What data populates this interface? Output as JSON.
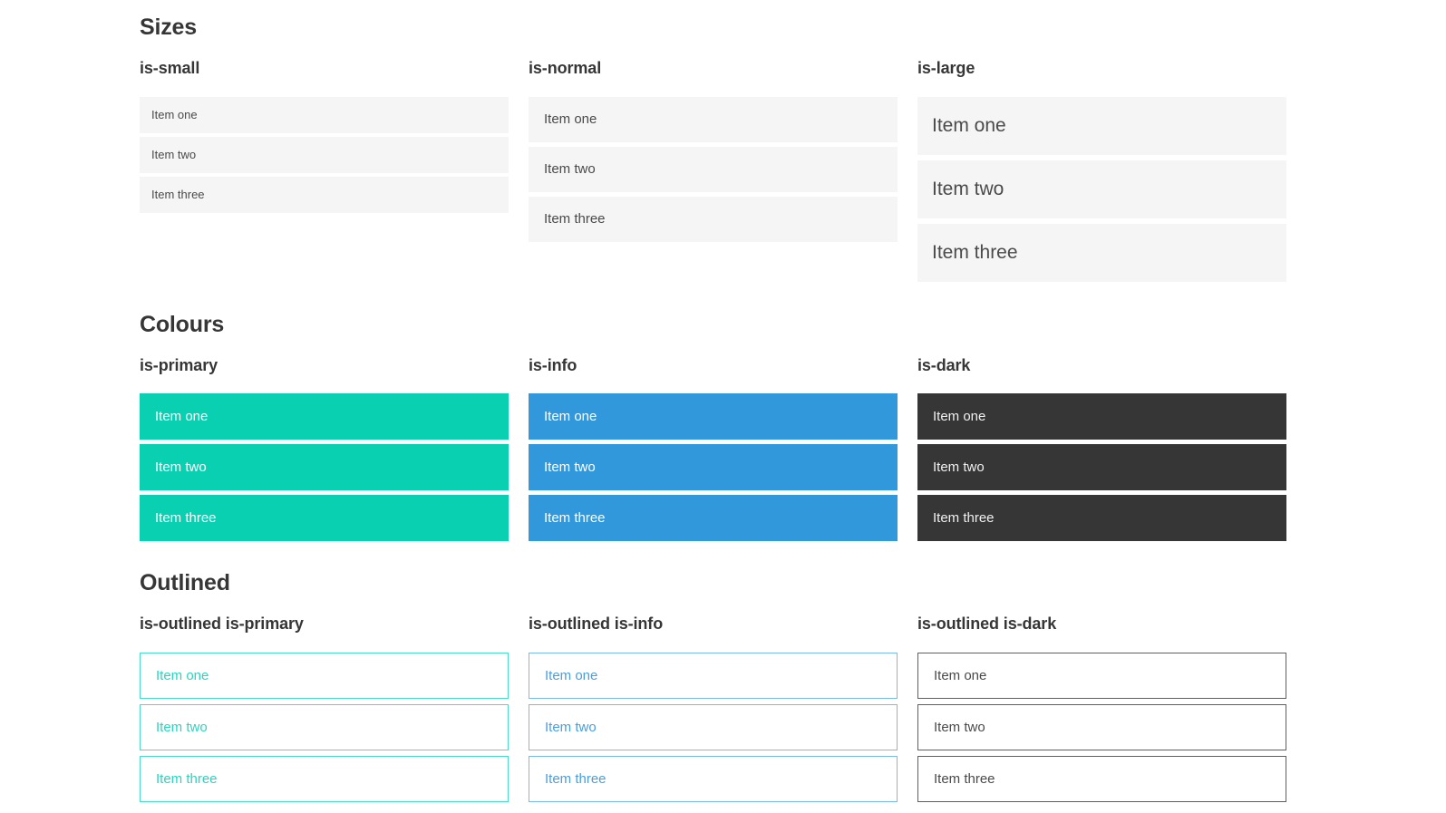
{
  "sections": [
    {
      "title": "Sizes",
      "groups": [
        {
          "label": "is-small",
          "items": [
            "Item one",
            "Item two",
            "Item three"
          ]
        },
        {
          "label": "is-normal",
          "items": [
            "Item one",
            "Item two",
            "Item three"
          ]
        },
        {
          "label": "is-large",
          "items": [
            "Item one",
            "Item two",
            "Item three"
          ]
        }
      ]
    },
    {
      "title": "Colours",
      "groups": [
        {
          "label": "is-primary",
          "items": [
            "Item one",
            "Item two",
            "Item three"
          ]
        },
        {
          "label": "is-info",
          "items": [
            "Item one",
            "Item two",
            "Item three"
          ]
        },
        {
          "label": "is-dark",
          "items": [
            "Item one",
            "Item two",
            "Item three"
          ]
        }
      ]
    },
    {
      "title": "Outlined",
      "groups": [
        {
          "label": "is-outlined is-primary",
          "items": [
            "Item one",
            "Item two",
            "Item three"
          ]
        },
        {
          "label": "is-outlined is-info",
          "items": [
            "Item one",
            "Item two",
            "Item three"
          ]
        },
        {
          "label": "is-outlined is-dark",
          "items": [
            "Item one",
            "Item two",
            "Item three"
          ]
        }
      ]
    }
  ],
  "colors": {
    "primary": "#0ad0b2",
    "info": "#3298dc",
    "dark": "#363636",
    "item_background": "#f5f5f5",
    "item_text": "#4a4a4a",
    "heading_text": "#363636",
    "outlined_primary_border": "#4adcc6",
    "outlined_primary_text": "#29d6bc",
    "outlined_info_border": "#79bbe9",
    "outlined_info_text": "#4a9ede",
    "outlined_dark_border": "#5f5f5f",
    "outlined_dark_text": "#4a4a4a"
  }
}
